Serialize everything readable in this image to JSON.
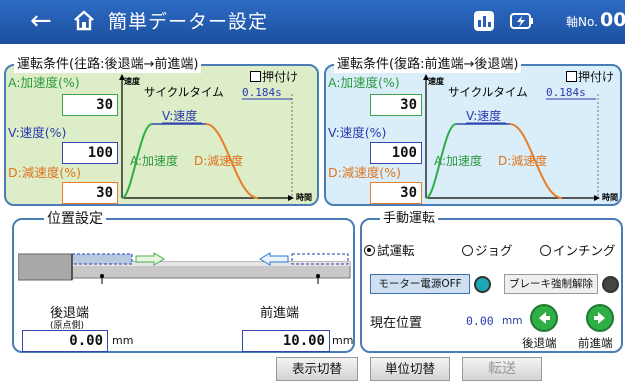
{
  "header": {
    "back_icon": "←",
    "title": "簡単データー設定",
    "axis_label": "軸No.",
    "axis_no": "00",
    "colors": {
      "bar": "#2561b8"
    }
  },
  "forward": {
    "title": "運転条件(往路:後退端→前進端)",
    "push": "押付け",
    "accel_label": "A:加速度(%)",
    "accel_value": "30",
    "speed_label": "V:速度(%)",
    "speed_value": "100",
    "decel_label": "D:減速度(%)",
    "decel_value": "30",
    "chart": {
      "y_axis": "速度",
      "x_axis": "時間",
      "cycle_label": "サイクルタイム",
      "cycle_value": "0.184s",
      "v_label": "V:速度",
      "a_label": "A:加速度",
      "d_label": "D:減速度"
    }
  },
  "backward": {
    "title": "運転条件(復路:前進端→後退端)",
    "push": "押付け",
    "accel_label": "A:加速度(%)",
    "accel_value": "30",
    "speed_label": "V:速度(%)",
    "speed_value": "100",
    "decel_label": "D:減速度(%)",
    "decel_value": "30",
    "chart": {
      "y_axis": "速度",
      "x_axis": "時間",
      "cycle_label": "サイクルタイム",
      "cycle_value": "0.184s",
      "v_label": "V:速度",
      "a_label": "A:加速度",
      "d_label": "D:減速度"
    }
  },
  "position": {
    "title": "位置設定",
    "back_end_label": "後退端",
    "back_end_sub": "(原点側)",
    "back_end_value": "0.00",
    "fwd_end_label": "前進端",
    "fwd_end_value": "10.00",
    "unit": "mm"
  },
  "manual": {
    "title": "手動運転",
    "modes": [
      "試運転",
      "ジョグ",
      "インチング"
    ],
    "selected_mode": "試運転",
    "motor_button": "モーター電源OFF",
    "brake_button": "ブレーキ強制解除",
    "current_pos_label": "現在位置",
    "current_pos_value": "0.00",
    "current_pos_unit": "mm",
    "back_end_btn": "後退端",
    "fwd_end_btn": "前進端"
  },
  "footer": {
    "display_switch": "表示切替",
    "unit_switch": "単位切替",
    "transfer": "転送"
  }
}
